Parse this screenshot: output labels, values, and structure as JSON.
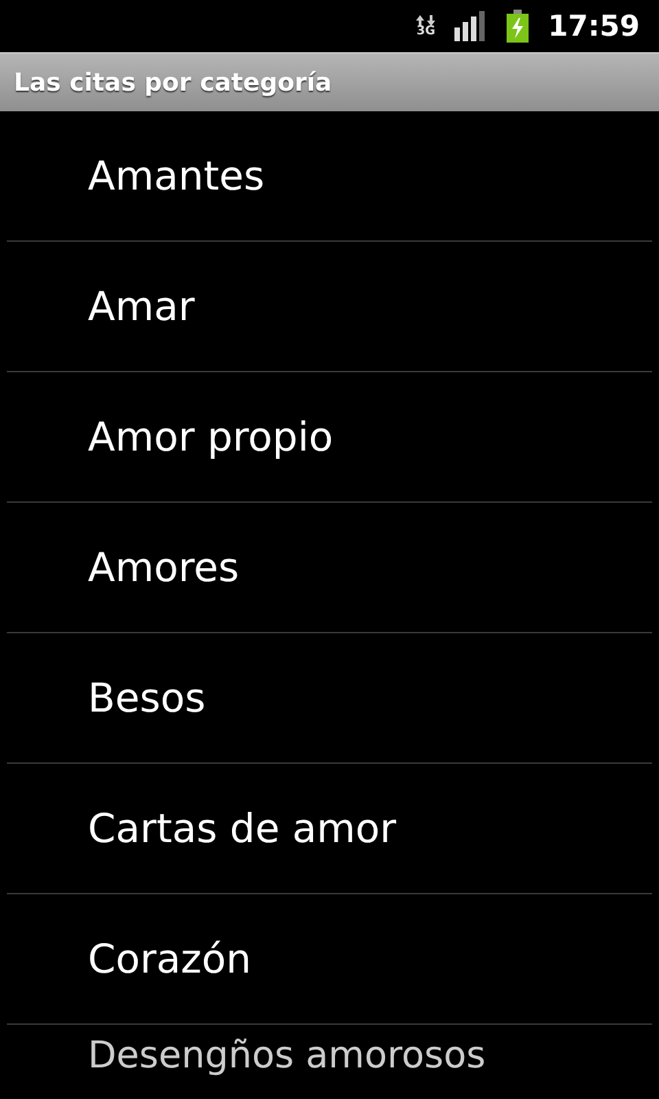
{
  "status_bar": {
    "network_type": "3G",
    "time": "17:59"
  },
  "title_bar": {
    "title": "Las citas por categoría"
  },
  "categories": [
    {
      "label": "Amantes"
    },
    {
      "label": "Amar"
    },
    {
      "label": "Amor propio"
    },
    {
      "label": "Amores"
    },
    {
      "label": "Besos"
    },
    {
      "label": "Cartas de amor"
    },
    {
      "label": "Corazón"
    },
    {
      "label": "Desengños amorosos"
    }
  ]
}
